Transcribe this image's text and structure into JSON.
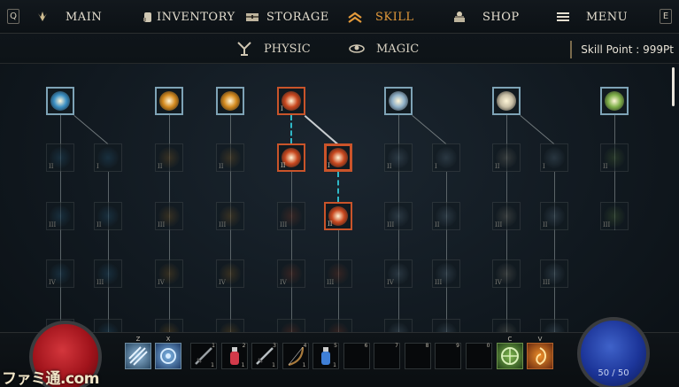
{
  "topbar": {
    "left_key": "Q",
    "right_key": "E",
    "tabs": [
      {
        "label": "MAIN",
        "icon": "wings-icon"
      },
      {
        "label": "INVENTORY",
        "icon": "hand-icon"
      },
      {
        "label": "STORAGE",
        "icon": "chest-icon"
      },
      {
        "label": "SKILL",
        "icon": "chevrons-icon",
        "active": true
      },
      {
        "label": "SHOP",
        "icon": "merchant-icon"
      },
      {
        "label": "MENU",
        "icon": "hamburger-icon"
      }
    ]
  },
  "subbar": {
    "tabs": [
      {
        "label": "PHYSIC",
        "icon": "strength-icon"
      },
      {
        "label": "MAGIC",
        "icon": "lotus-icon"
      }
    ],
    "skill_point": "Skill Point : 999Pt"
  },
  "tree": {
    "columns": [
      {
        "color": "#3a8fc4",
        "nodes": [
          {
            "roman": "",
            "active": true
          },
          {
            "roman": "II"
          },
          {
            "roman": "III"
          },
          {
            "roman": "IV"
          },
          {
            "roman": ""
          }
        ]
      },
      {
        "color": "#3a8fc4",
        "nodes": [
          {
            "roman": "I"
          },
          {
            "roman": "II"
          },
          {
            "roman": "III"
          },
          {
            "roman": ""
          }
        ]
      },
      {
        "color": "#d48a1e",
        "nodes": [
          {
            "roman": "",
            "active": true
          },
          {
            "roman": "II"
          },
          {
            "roman": "III"
          },
          {
            "roman": "IV"
          },
          {
            "roman": ""
          }
        ]
      },
      {
        "color": "#d48a1e",
        "nodes": [
          {
            "roman": "",
            "active": true
          },
          {
            "roman": "II"
          },
          {
            "roman": "III"
          },
          {
            "roman": "IV"
          },
          {
            "roman": ""
          }
        ]
      },
      {
        "color": "#c9481f",
        "nodes": [
          {
            "roman": "I",
            "active": true
          },
          {
            "roman": "II",
            "active": true
          },
          {
            "roman": "III"
          },
          {
            "roman": "IV"
          },
          {
            "roman": ""
          }
        ]
      },
      {
        "color": "#c9481f",
        "nodes": [
          {
            "roman": "I",
            "active": true,
            "selected": true
          },
          {
            "roman": "II",
            "active": true
          },
          {
            "roman": "III"
          },
          {
            "roman": ""
          }
        ]
      },
      {
        "color": "#8fb0c8",
        "nodes": [
          {
            "roman": "",
            "active": true
          },
          {
            "roman": "II"
          },
          {
            "roman": "III"
          },
          {
            "roman": "IV"
          },
          {
            "roman": ""
          }
        ]
      },
      {
        "color": "#8fb0c8",
        "nodes": [
          {
            "roman": "I"
          },
          {
            "roman": "II"
          },
          {
            "roman": "III"
          },
          {
            "roman": ""
          }
        ]
      },
      {
        "color": "#c8bfa6",
        "nodes": [
          {
            "roman": "",
            "active": true
          },
          {
            "roman": "II"
          },
          {
            "roman": "III"
          },
          {
            "roman": "IV"
          },
          {
            "roman": ""
          }
        ]
      },
      {
        "color": "#8fb0c8",
        "nodes": [
          {
            "roman": "I"
          },
          {
            "roman": "II"
          },
          {
            "roman": "III"
          },
          {
            "roman": ""
          }
        ]
      },
      {
        "color": "#7fb04a",
        "nodes": [
          {
            "roman": "",
            "active": true
          },
          {
            "roman": "II"
          },
          {
            "roman": "III"
          }
        ]
      }
    ]
  },
  "hotbar": {
    "skill_keys": [
      "Z",
      "X"
    ],
    "item_slots": [
      {
        "num": "1",
        "count": "1",
        "icon": "sword-icon",
        "color": "#9aa0a4"
      },
      {
        "num": "2",
        "count": "1",
        "icon": "red-potion-icon",
        "color": "#d23a4a"
      },
      {
        "num": "3",
        "count": "1",
        "icon": "katana-icon",
        "color": "#b8bec2"
      },
      {
        "num": "4",
        "count": "1",
        "icon": "bow-icon",
        "color": "#a87a3c"
      },
      {
        "num": "5",
        "count": "1",
        "icon": "blue-potion-icon",
        "color": "#3f7fd6"
      },
      {
        "num": "6",
        "count": "",
        "icon": "",
        "color": ""
      },
      {
        "num": "7",
        "count": "",
        "icon": "",
        "color": ""
      },
      {
        "num": "8",
        "count": "",
        "icon": "",
        "color": ""
      },
      {
        "num": "9",
        "count": "",
        "icon": "",
        "color": ""
      },
      {
        "num": "0",
        "count": "",
        "icon": "",
        "color": ""
      }
    ],
    "right_keys": [
      "C",
      "V"
    ]
  },
  "mp_text": "50 / 50",
  "watermark": "ファミ通.com"
}
